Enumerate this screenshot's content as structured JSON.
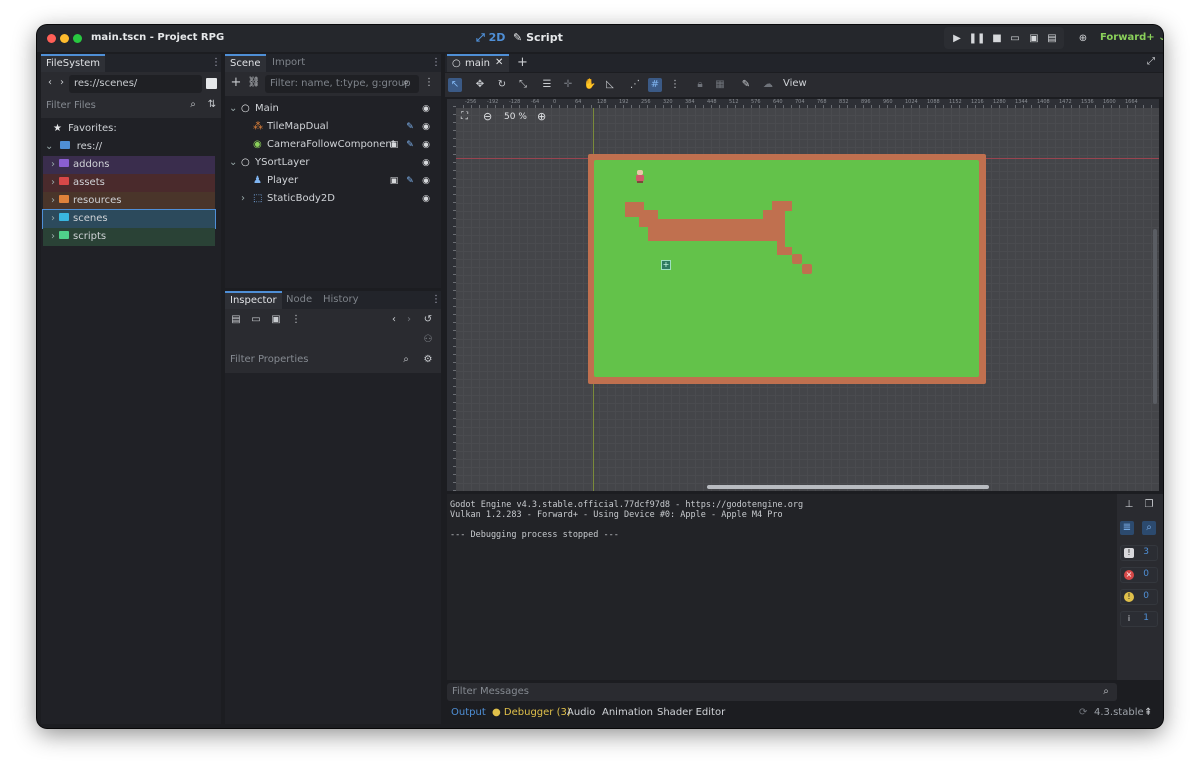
{
  "window": {
    "title": "main.tscn - Project RPG",
    "mode_2d": "2D",
    "mode_script": "Script",
    "renderer": "Forward+"
  },
  "colors": {
    "accent": "#4f8fd6",
    "grass": "#63c24a",
    "dirt": "#c0704f",
    "renderer_green": "#8ad05a",
    "debugger_yellow": "#e0c04a"
  },
  "filesystem": {
    "tab": "FileSystem",
    "path": "res://scenes/",
    "filter_placeholder": "Filter Files",
    "favorites": "Favorites:",
    "root": "res://",
    "folders": [
      {
        "label": "addons",
        "color": "#8a5fd1",
        "bg": "#3a2d4d"
      },
      {
        "label": "assets",
        "color": "#d64848",
        "bg": "#4a2a2c"
      },
      {
        "label": "resources",
        "color": "#e0823a",
        "bg": "#4a352a"
      },
      {
        "label": "scenes",
        "color": "#39b6e0",
        "bg": "#2c4a5c"
      },
      {
        "label": "scripts",
        "color": "#4fd08a",
        "bg": "#2a4236"
      }
    ]
  },
  "scene_dock": {
    "tab_scene": "Scene",
    "tab_import": "Import",
    "filter_placeholder": "Filter: name, t:type, g:group",
    "nodes": [
      {
        "label": "Main",
        "icon": "circle-node-icon"
      },
      {
        "label": "TileMapDual",
        "icon": "tilemap-icon"
      },
      {
        "label": "CameraFollowComponent",
        "icon": "component-icon"
      },
      {
        "label": "YSortLayer",
        "icon": "circle-node-icon"
      },
      {
        "label": "Player",
        "icon": "character-body-icon"
      },
      {
        "label": "StaticBody2D",
        "icon": "static-body-icon"
      }
    ]
  },
  "inspector": {
    "tab_inspector": "Inspector",
    "tab_node": "Node",
    "tab_history": "History",
    "filter_placeholder": "Filter Properties"
  },
  "editor": {
    "scene_tab": "main",
    "view_menu": "View",
    "zoom": "50 %"
  },
  "ruler": {
    "labels": [
      "-256",
      "-192",
      "-128",
      "-64",
      "0",
      "64",
      "128",
      "192",
      "256",
      "320",
      "384",
      "448",
      "512",
      "576",
      "640",
      "704",
      "768",
      "832",
      "896",
      "960",
      "1024",
      "1088",
      "1152",
      "1216",
      "1280",
      "1344",
      "1408",
      "1472",
      "1536",
      "1600",
      "1664"
    ]
  },
  "console": {
    "lines": [
      "Godot Engine v4.3.stable.official.77dcf97d8 - https://godotengine.org",
      "Vulkan 1.2.283 - Forward+ - Using Device #0: Apple - Apple M4 Pro",
      "",
      "--- Debugging process stopped ---"
    ],
    "filter_placeholder": "Filter Messages",
    "counts": {
      "errors_all": "3",
      "errors": "0",
      "warnings": "0",
      "messages": "1"
    }
  },
  "bottom_panel": {
    "output": "Output",
    "debugger": "Debugger (3)",
    "audio": "Audio",
    "animation": "Animation",
    "shader_editor": "Shader Editor",
    "version": "4.3.stable"
  }
}
